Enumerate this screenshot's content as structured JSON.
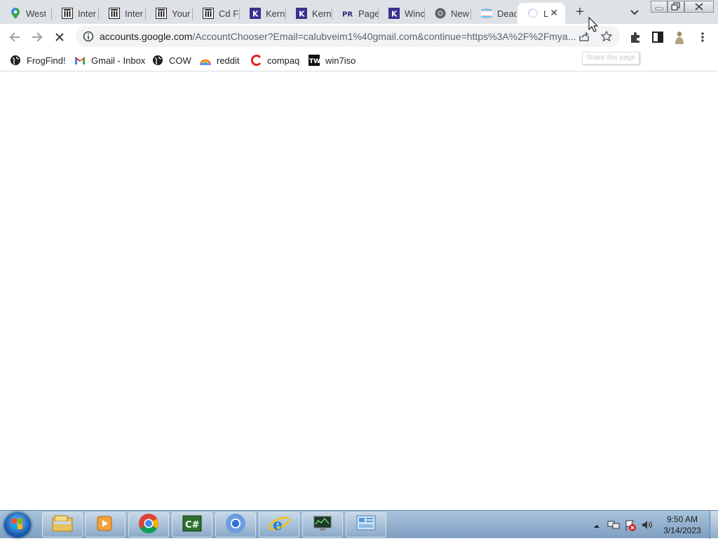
{
  "tabs": [
    {
      "title": "West",
      "icon": "maps-pin-icon"
    },
    {
      "title": "Inter",
      "icon": "archive-icon"
    },
    {
      "title": "Inter",
      "icon": "archive-icon"
    },
    {
      "title": "Your",
      "icon": "archive-icon"
    },
    {
      "title": "Cd F",
      "icon": "archive-icon"
    },
    {
      "title": "Kern",
      "icon": "k-logo-icon"
    },
    {
      "title": "Kern",
      "icon": "k-logo-icon"
    },
    {
      "title": "Page",
      "icon": "pr-logo-icon"
    },
    {
      "title": "Winc",
      "icon": "k-logo-icon"
    },
    {
      "title": "New",
      "icon": "chrome-icon"
    },
    {
      "title": "Deac",
      "icon": "flag-icon"
    },
    {
      "title": "L",
      "icon": "loading-spinner-icon",
      "active": true
    }
  ],
  "newtab_label": "+",
  "toolbar": {
    "url_host": "accounts.google.com",
    "url_rest": "/AccountChooser?Email=calubveim1%40gmail.com&continue=https%3A%2F%2Fmya..."
  },
  "tooltip": "Share this page",
  "bookmarks": [
    {
      "label": "FrogFind!",
      "icon": "globe-icon"
    },
    {
      "label": "Gmail - Inbox",
      "icon": "gmail-icon"
    },
    {
      "label": "COW",
      "icon": "globe-icon"
    },
    {
      "label": "reddit",
      "icon": "reddit-icon"
    },
    {
      "label": "compaq",
      "icon": "compaq-icon"
    },
    {
      "label": "win7iso",
      "icon": "tw-icon"
    }
  ],
  "taskbar": {
    "items": [
      "file-explorer-icon",
      "media-player-icon",
      "chrome-icon",
      "csharp-icon",
      "chromium-icon",
      "internet-explorer-icon",
      "monitor-app-icon",
      "control-panel-icon"
    ],
    "time": "9:50 AM",
    "date": "3/14/2023"
  },
  "colors": {
    "tabstrip": "#dee1e6",
    "omnibox": "#f1f3f4",
    "taskbar": "#8eaed0"
  }
}
